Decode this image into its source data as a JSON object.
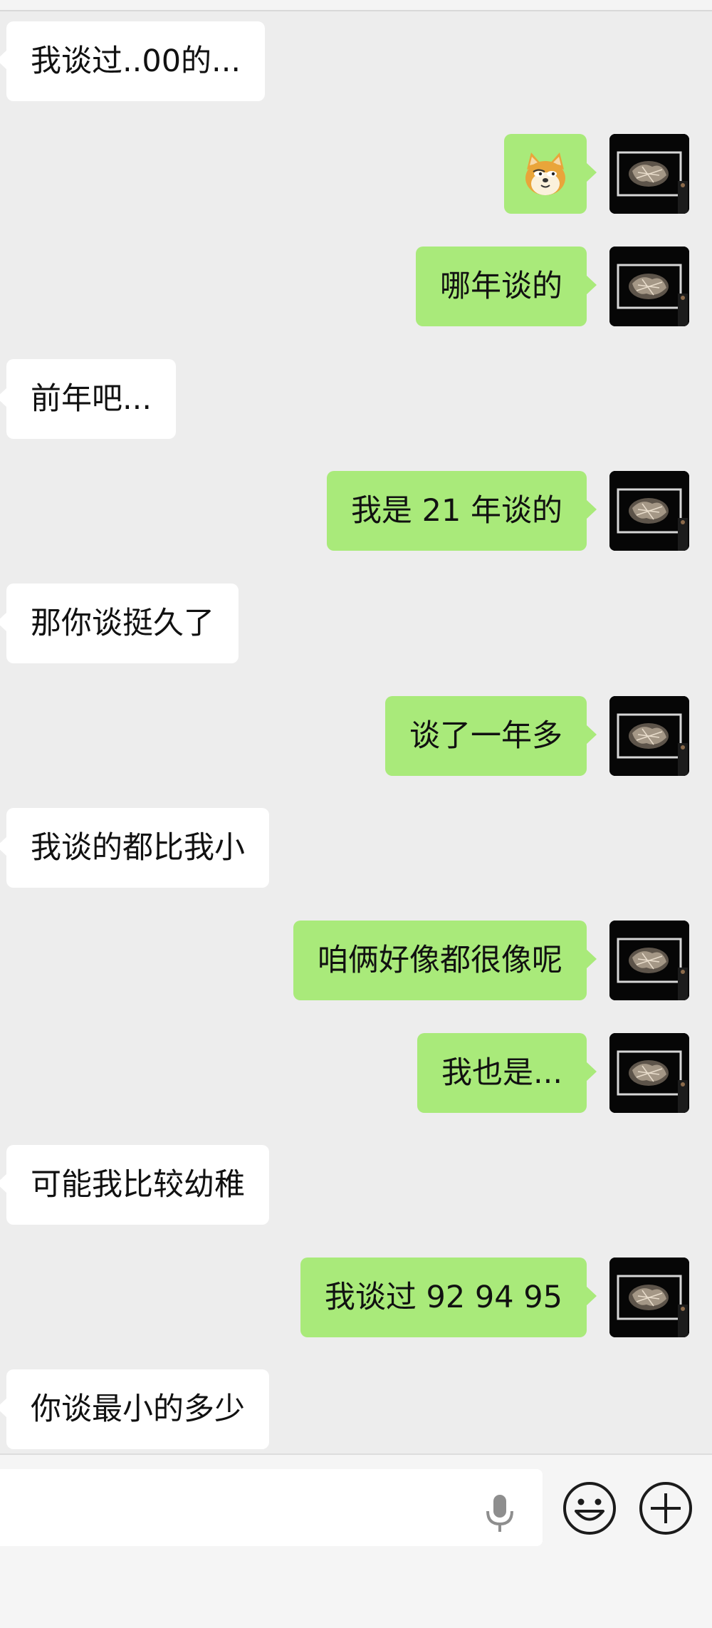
{
  "messages": [
    {
      "side": "in",
      "text": "我谈过..00的..."
    },
    {
      "side": "out",
      "text": "",
      "emoji": "doge-emoji"
    },
    {
      "side": "out",
      "text": "哪年谈的"
    },
    {
      "side": "in",
      "text": "前年吧..."
    },
    {
      "side": "out",
      "text": "我是 21 年谈的"
    },
    {
      "side": "in",
      "text": "那你谈挺久了"
    },
    {
      "side": "out",
      "text": "谈了一年多"
    },
    {
      "side": "in",
      "text": "我谈的都比我小"
    },
    {
      "side": "out",
      "text": "咱俩好像都很像呢"
    },
    {
      "side": "out",
      "text": "我也是..."
    },
    {
      "side": "in",
      "text": "可能我比较幼稚"
    },
    {
      "side": "out",
      "text": "我谈过 92 94 95"
    },
    {
      "side": "in",
      "text": "你谈最小的多少"
    }
  ],
  "input": {
    "value": "",
    "voice_icon": "microphone-icon",
    "emoji_icon": "smiley-icon",
    "more_icon": "plus-circle-icon"
  },
  "colors": {
    "background": "#ededed",
    "outgoing_bubble": "#a9ea7a",
    "incoming_bubble": "#ffffff"
  }
}
